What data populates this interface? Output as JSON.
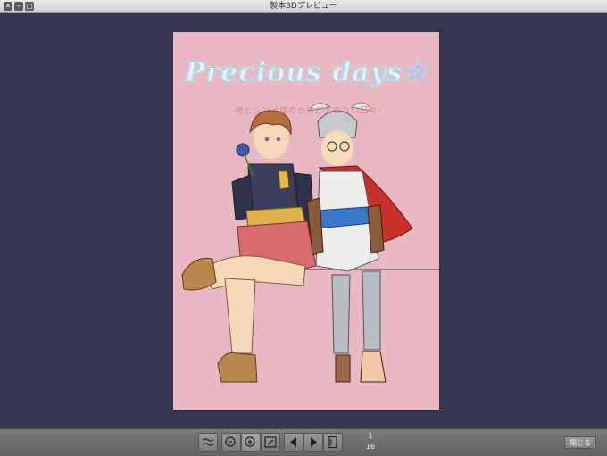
{
  "window": {
    "title": "製本3Dプレビュー"
  },
  "cover": {
    "title": "Precious days☆",
    "subtitle": "-俺とシンイ様のかけがえのない日々-",
    "background_color": "#e8b9c3",
    "title_color": "#dff4fb",
    "subtitle_color": "#d8857e"
  },
  "toolbar": {
    "buttons": [
      {
        "icon": "page-curl-icon"
      },
      {
        "icon": "zoom-out-icon"
      },
      {
        "icon": "zoom-in-icon"
      },
      {
        "icon": "fit-window-icon"
      },
      {
        "icon": "previous-page-icon"
      },
      {
        "icon": "next-page-icon"
      },
      {
        "icon": "page-spread-icon"
      }
    ],
    "current_page": "1",
    "total_pages": "16",
    "close_label": "閉じる"
  }
}
